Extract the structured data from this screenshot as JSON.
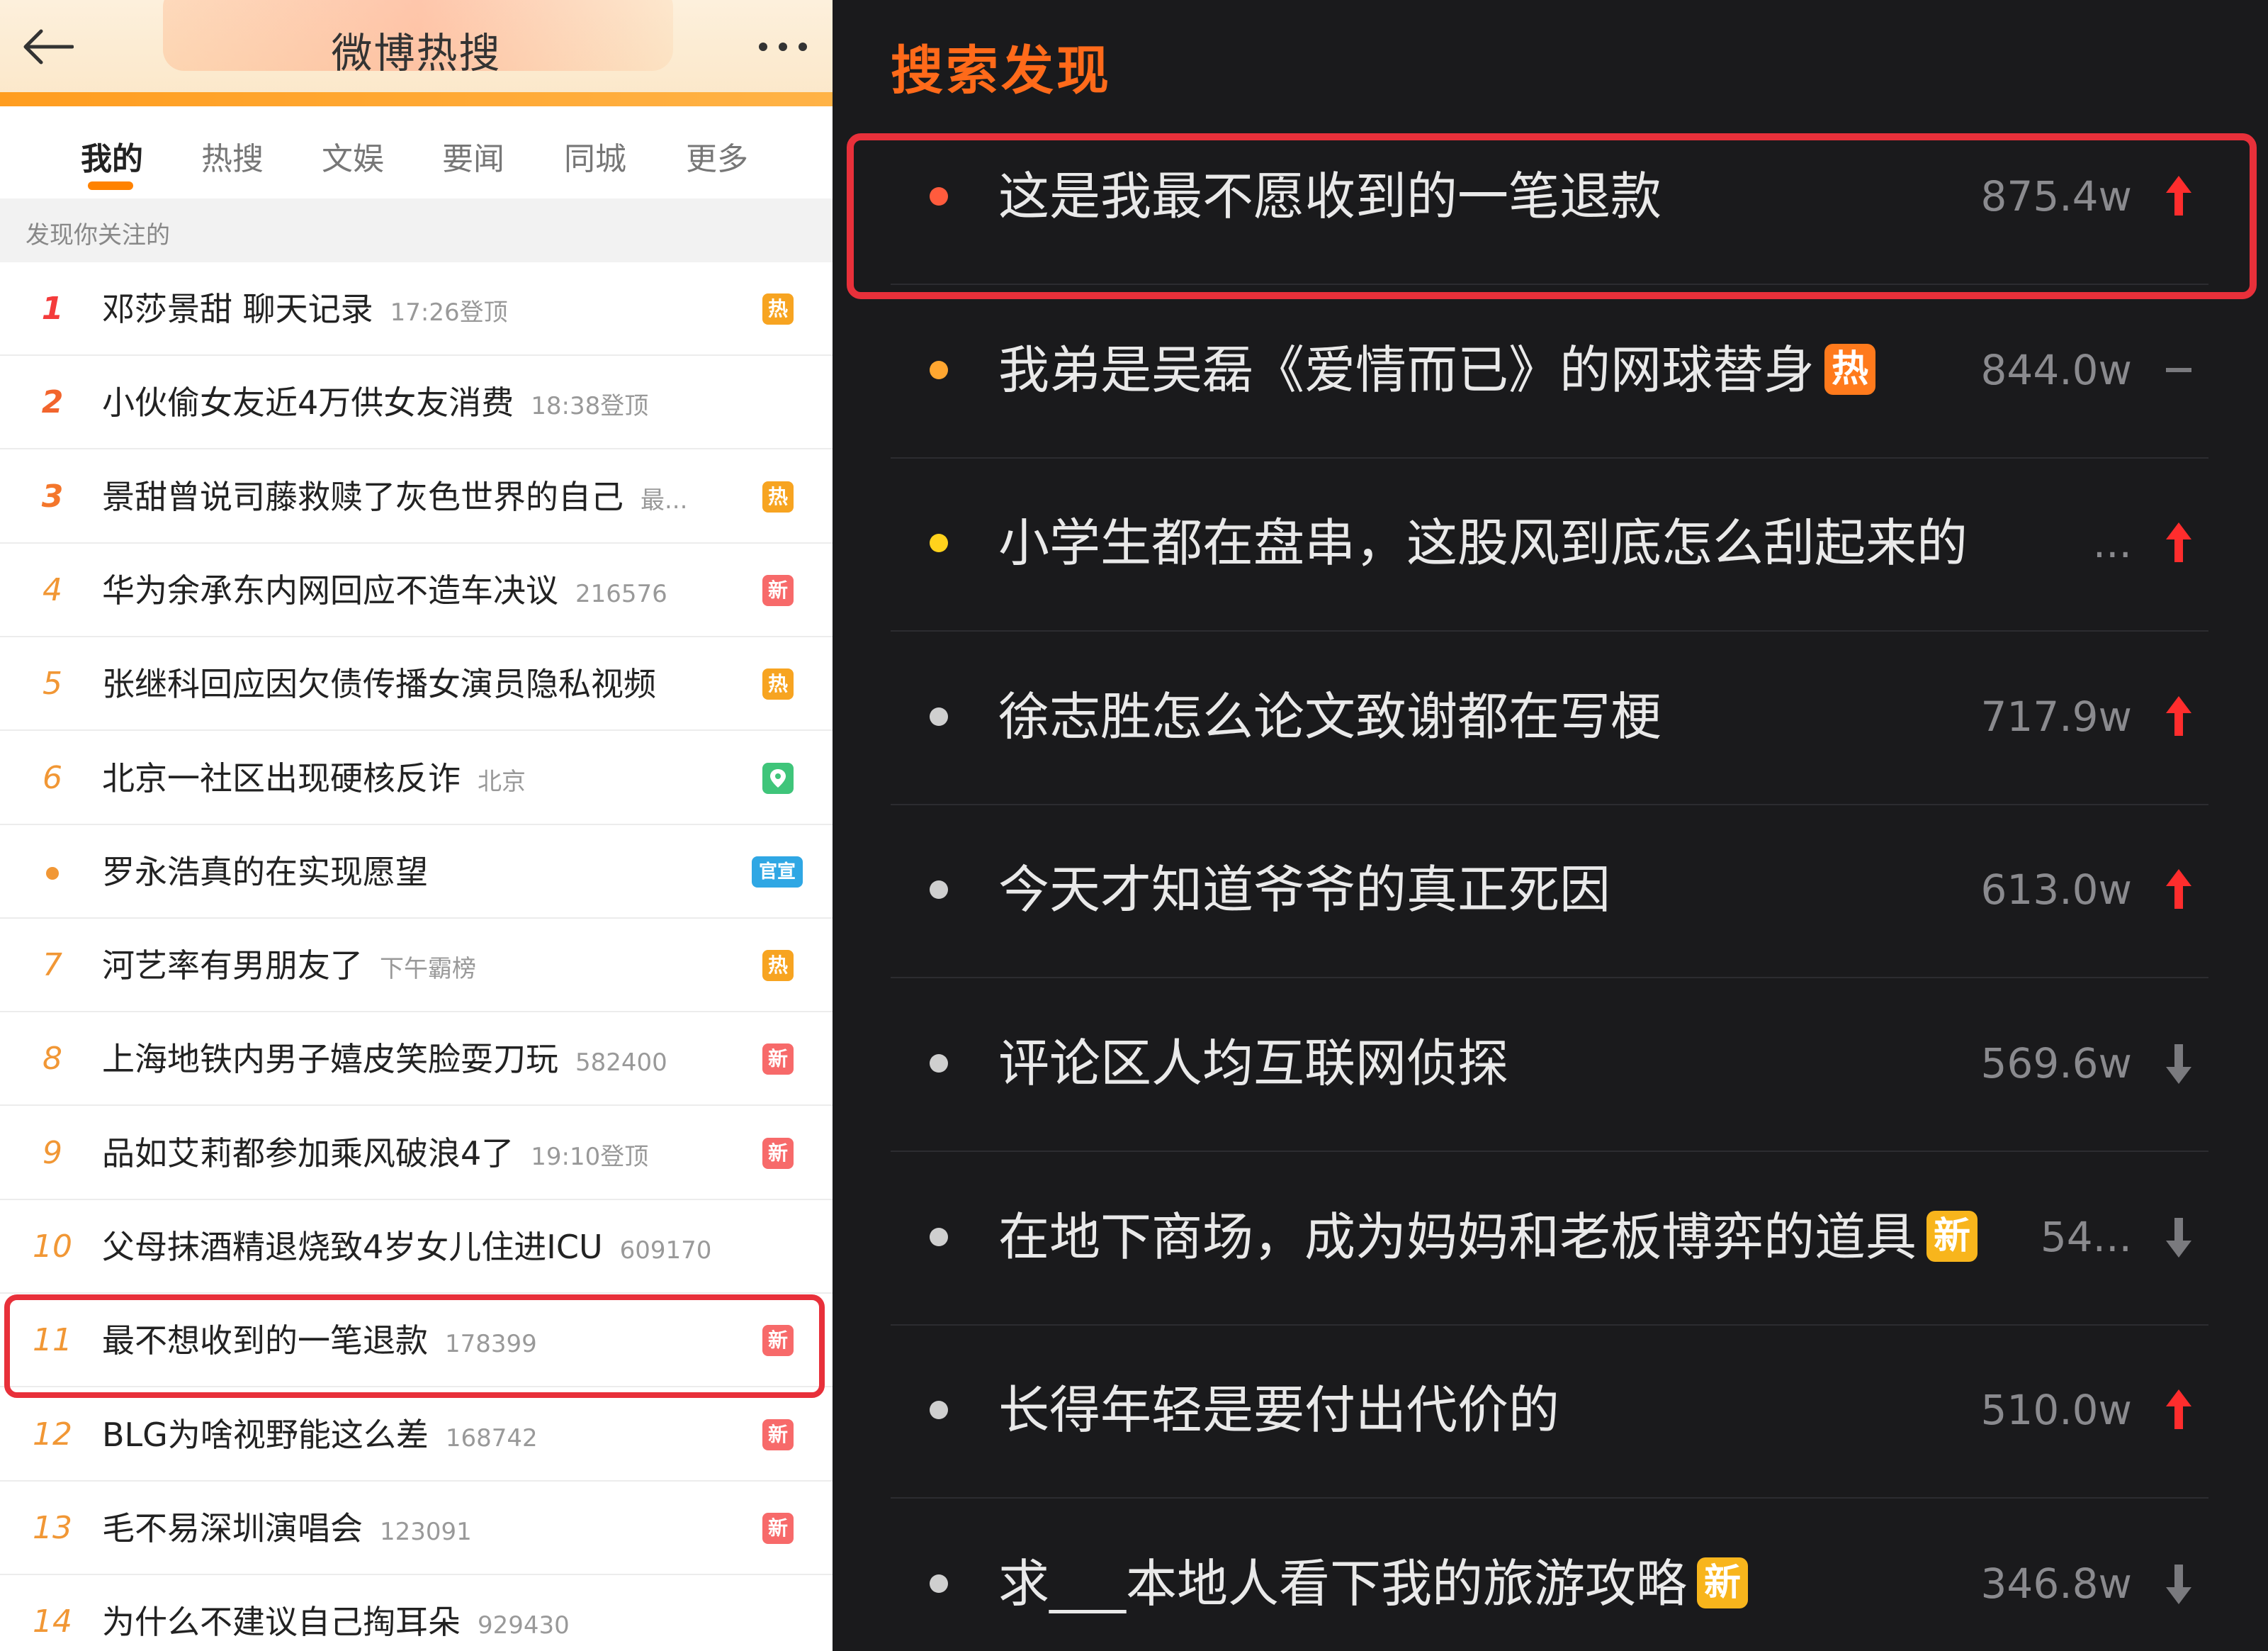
{
  "left": {
    "header": {
      "title": "微博热搜",
      "back_icon": "back-arrow-icon",
      "more_icon": "more-dots-icon",
      "accent": "#ff8200"
    },
    "tabs": [
      {
        "label": "我的",
        "active": true
      },
      {
        "label": "热搜",
        "active": false
      },
      {
        "label": "文娱",
        "active": false
      },
      {
        "label": "要闻",
        "active": false
      },
      {
        "label": "同城",
        "active": false
      },
      {
        "label": "更多",
        "active": false
      }
    ],
    "section_label": "发现你关注的",
    "items": [
      {
        "rank": "1",
        "title": "邓莎景甜 聊天记录",
        "meta": "17:26登顶",
        "badge": "热"
      },
      {
        "rank": "2",
        "title": "小伙偷女友近4万供女友消费",
        "meta": "18:38登顶",
        "badge": ""
      },
      {
        "rank": "3",
        "title": "景甜曾说司藤救赎了灰色世界的自己",
        "meta": "最...",
        "badge": "热"
      },
      {
        "rank": "4",
        "title": "华为余承东内网回应不造车决议",
        "meta": "216576",
        "badge": "新"
      },
      {
        "rank": "5",
        "title": "张继科回应因欠债传播女演员隐私视频",
        "meta": "",
        "badge": "热"
      },
      {
        "rank": "6",
        "title": "北京一社区出现硬核反诈",
        "meta": "北京",
        "badge": "location"
      },
      {
        "rank": "•",
        "title": "罗永浩真的在实现愿望",
        "meta": "",
        "badge": "官宣"
      },
      {
        "rank": "7",
        "title": "河艺率有男朋友了",
        "meta": "下午霸榜",
        "badge": "热"
      },
      {
        "rank": "8",
        "title": "上海地铁内男子嬉皮笑脸耍刀玩",
        "meta": "582400",
        "badge": "新"
      },
      {
        "rank": "9",
        "title": "品如艾莉都参加乘风破浪4了",
        "meta": "19:10登顶",
        "badge": "新"
      },
      {
        "rank": "10",
        "title": "父母抹酒精退烧致4岁女儿住进ICU",
        "meta": "609170",
        "badge": ""
      },
      {
        "rank": "11",
        "title": "最不想收到的一笔退款",
        "meta": "178399",
        "badge": "新"
      },
      {
        "rank": "12",
        "title": "BLG为啥视野能这么差",
        "meta": "168742",
        "badge": "新"
      },
      {
        "rank": "13",
        "title": "毛不易深圳演唱会",
        "meta": "123091",
        "badge": "新"
      },
      {
        "rank": "14",
        "title": "为什么不建议自己掏耳朵",
        "meta": "929430",
        "badge": ""
      }
    ]
  },
  "right": {
    "title": "搜索发现",
    "title_color": "#ff6a1a",
    "items": [
      {
        "title": "这是我最不愿收到的一笔退款",
        "badge": "",
        "count": "875.4w",
        "trend": "up",
        "dot": "#ff5b3d"
      },
      {
        "title": "我弟是吴磊《爱情而已》的网球替身",
        "badge": "热",
        "count": "844.0w",
        "trend": "flat",
        "dot": "#ffa630"
      },
      {
        "title": "小学生都在盘串，这股风到底怎么刮起来的",
        "badge": "",
        "count": "...",
        "trend": "up",
        "dot": "#ffd21c"
      },
      {
        "title": "徐志胜怎么论文致谢都在写梗",
        "badge": "",
        "count": "717.9w",
        "trend": "up",
        "dot": "#cfcfcf"
      },
      {
        "title": "今天才知道爷爷的真正死因",
        "badge": "",
        "count": "613.0w",
        "trend": "up",
        "dot": "#cfcfcf"
      },
      {
        "title": "评论区人均互联网侦探",
        "badge": "",
        "count": "569.6w",
        "trend": "down",
        "dot": "#cfcfcf"
      },
      {
        "title": "在地下商场，成为妈妈和老板博弈的道具",
        "badge": "新",
        "count": "54...",
        "trend": "down",
        "dot": "#cfcfcf"
      },
      {
        "title": "长得年轻是要付出代价的",
        "badge": "",
        "count": "510.0w",
        "trend": "up",
        "dot": "#cfcfcf"
      },
      {
        "title": "求___本地人看下我的旅游攻略",
        "badge": "新",
        "count": "346.8w",
        "trend": "down",
        "dot": "#cfcfcf"
      }
    ]
  },
  "colors": {
    "up_arrow": "#ff2d2d",
    "down_arrow": "#7a7a7e",
    "highlight": "#e8303a"
  }
}
